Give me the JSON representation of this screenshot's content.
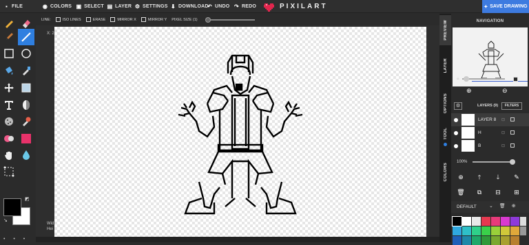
{
  "topbar": {
    "menu": [
      {
        "label": "FILE",
        "icon": "file-icon"
      },
      {
        "label": "COLORS",
        "icon": "palette-icon"
      },
      {
        "label": "SELECT",
        "icon": "select-icon"
      },
      {
        "label": "LAYER",
        "icon": "layer-icon"
      },
      {
        "label": "SETTINGS",
        "icon": "gears-icon"
      },
      {
        "label": "DOWNLOAD",
        "icon": "download-icon"
      },
      {
        "label": "UNDO",
        "icon": "undo-icon"
      },
      {
        "label": "REDO",
        "icon": "redo-icon"
      }
    ],
    "brand": "PIXILART",
    "save_label": "SAVE DRAWING",
    "brand_color": "#e2264d",
    "accent_color": "#3d7be0"
  },
  "options": {
    "line_label": "LINE:",
    "iso_lines": "ISO LINES",
    "erase": "ERASE",
    "mirror_x": "MIRROR X",
    "mirror_y": "MIRROR Y",
    "pixel_size": "PIXEL SIZE (1)"
  },
  "canvas": {
    "coords": "X: 2",
    "size_lines": [
      "Wid",
      "Hei"
    ]
  },
  "tabs": [
    "PREVIEW",
    "LAYER",
    "OPTIONS",
    "TOOL",
    "COLORS"
  ],
  "panel": {
    "nav_title": "NAVIGATION",
    "layers_label": "LAYERS (9)",
    "filters_label": "FILTERS",
    "layers": [
      {
        "name": "LAYER 8",
        "active": true
      },
      {
        "name": "H",
        "active": false
      },
      {
        "name": "B",
        "active": false
      }
    ],
    "opacity": "100%",
    "palette_name": "DEFAULT"
  },
  "palette_colors": [
    "#000000",
    "#ffffff",
    "#e8e8e8",
    "#e53950",
    "#e83a7a",
    "#d93ad0",
    "#8e3ad9",
    "#2fa8e0",
    "#2fc0c8",
    "#2fd08a",
    "#3ad04a",
    "#9ad03a",
    "#d0c83a",
    "#e0a83a",
    "#1e5fb8",
    "#1e88a8",
    "#1ea86a",
    "#2f9a3a",
    "#7aa82f",
    "#a8a02f",
    "#b8802f"
  ]
}
